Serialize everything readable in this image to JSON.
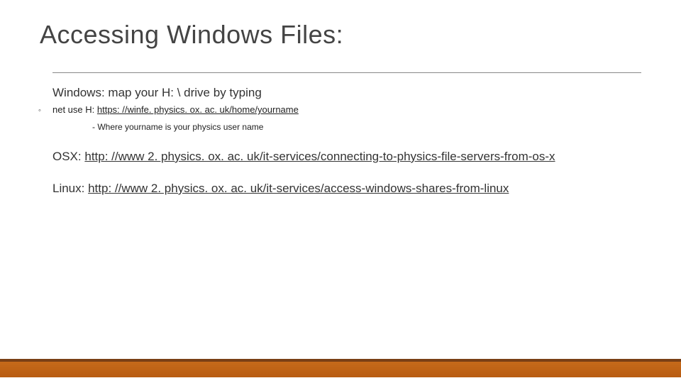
{
  "title": "Accessing Windows Files:",
  "windows": {
    "heading": "Windows: map your H: \\ drive by typing",
    "bullet_prefix": "net use H: ",
    "bullet_link": "https: //winfe. physics. ox. ac. uk/home/yourname",
    "sub_note": "- Where yourname is your physics user name"
  },
  "osx": {
    "label": "OSX: ",
    "link": "http: //www 2. physics. ox. ac. uk/it-services/connecting-to-physics-file-servers-from-os-x"
  },
  "linux": {
    "label": "Linux: ",
    "link": "http: //www 2. physics. ox. ac. uk/it-services/access-windows-shares-from-linux"
  }
}
